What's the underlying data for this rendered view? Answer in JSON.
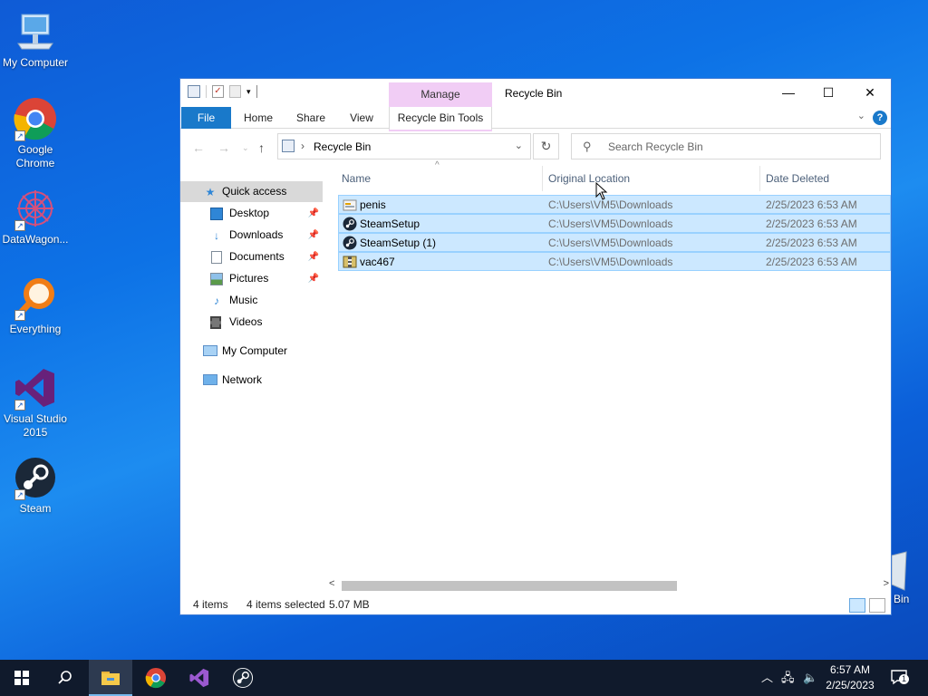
{
  "desktop": {
    "icons": [
      {
        "label": "My Computer"
      },
      {
        "label": "Google Chrome"
      },
      {
        "label": "DataWagon..."
      },
      {
        "label": "Everything"
      },
      {
        "label": "Visual Studio 2015"
      },
      {
        "label": "Steam"
      }
    ],
    "recycle_bin_label": "Bin"
  },
  "window": {
    "title": "Recycle Bin",
    "context_group": "Manage",
    "tabs": [
      "File",
      "Home",
      "Share",
      "View",
      "Recycle Bin Tools"
    ],
    "address": {
      "location": "Recycle Bin"
    },
    "search_placeholder": "Search Recycle Bin",
    "sidebar": {
      "items": [
        {
          "label": "Quick access",
          "icon": "star-icon",
          "pinned": false,
          "selected": true
        },
        {
          "label": "Desktop",
          "icon": "desktop-icon",
          "pinned": true
        },
        {
          "label": "Downloads",
          "icon": "download-icon",
          "pinned": true
        },
        {
          "label": "Documents",
          "icon": "documents-icon",
          "pinned": true
        },
        {
          "label": "Pictures",
          "icon": "pictures-icon",
          "pinned": true
        },
        {
          "label": "Music",
          "icon": "music-icon",
          "pinned": false
        },
        {
          "label": "Videos",
          "icon": "videos-icon",
          "pinned": false
        },
        {
          "label": "My Computer",
          "icon": "computer-icon",
          "pinned": false
        },
        {
          "label": "Network",
          "icon": "network-icon",
          "pinned": false
        }
      ]
    },
    "columns": [
      "Name",
      "Original Location",
      "Date Deleted"
    ],
    "files": [
      {
        "name": "penis",
        "location": "C:\\Users\\VM5\\Downloads",
        "date": "2/25/2023 6:53 AM",
        "icon": "installer-icon"
      },
      {
        "name": "SteamSetup",
        "location": "C:\\Users\\VM5\\Downloads",
        "date": "2/25/2023 6:53 AM",
        "icon": "steam-icon"
      },
      {
        "name": "SteamSetup (1)",
        "location": "C:\\Users\\VM5\\Downloads",
        "date": "2/25/2023 6:53 AM",
        "icon": "steam-icon"
      },
      {
        "name": "vac467",
        "location": "C:\\Users\\VM5\\Downloads",
        "date": "2/25/2023 6:53 AM",
        "icon": "archive-icon"
      }
    ],
    "status": {
      "items": "4 items",
      "selected": "4 items selected",
      "size": "5.07 MB"
    }
  },
  "taskbar": {
    "clock_time": "6:57 AM",
    "clock_date": "2/25/2023",
    "notification_count": "1"
  },
  "colors": {
    "accent": "#1979ca",
    "selection": "#cce8ff",
    "manage": "#f1cdf5",
    "taskbar": "#101a2c"
  }
}
